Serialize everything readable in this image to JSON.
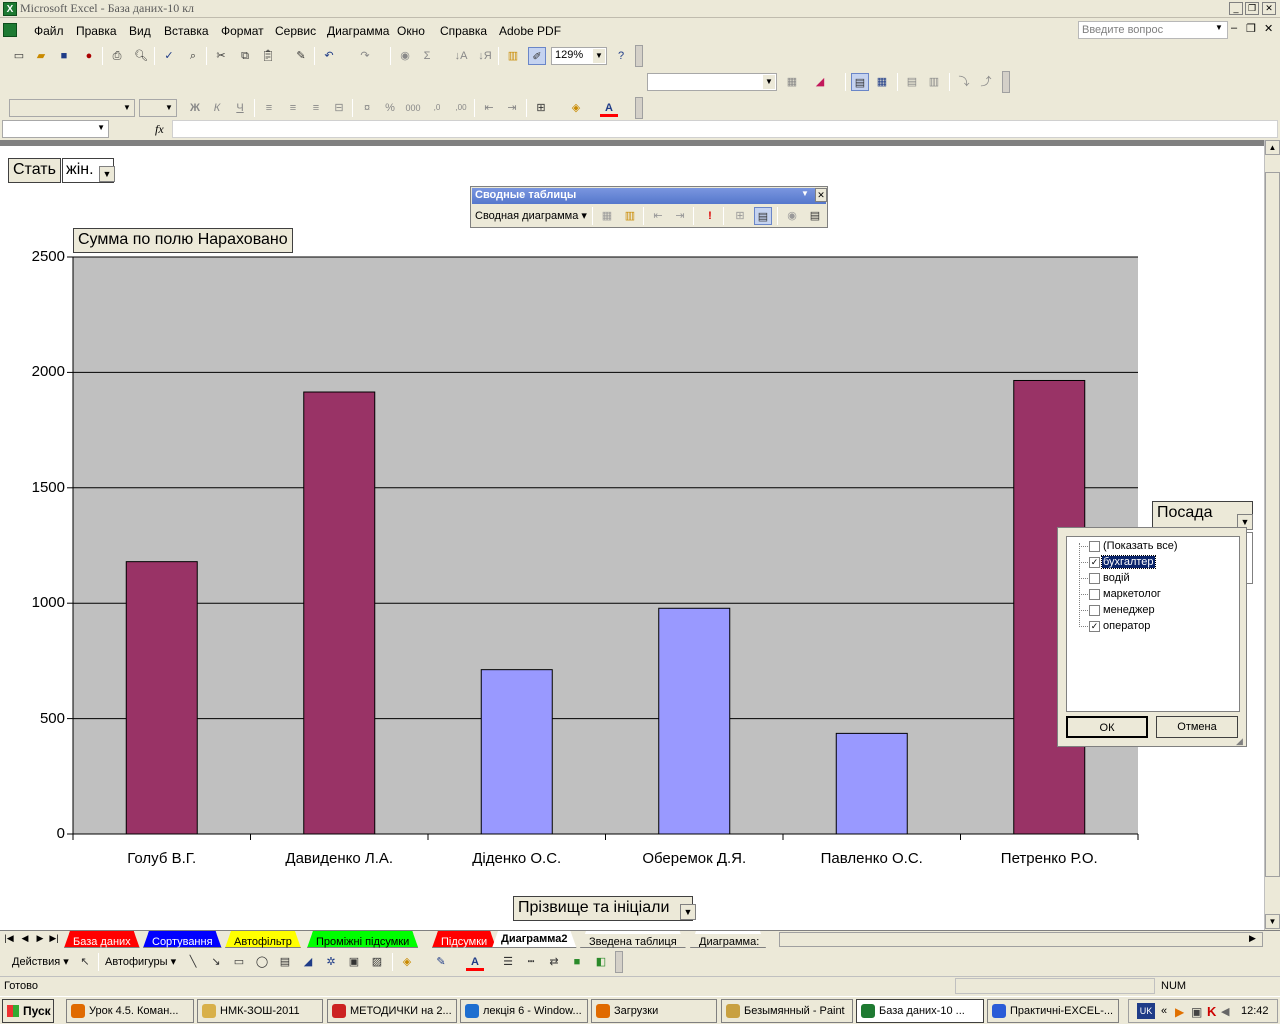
{
  "window": {
    "title": "Microsoft Excel - База даних-10 кл",
    "app_icon": "X"
  },
  "menu": {
    "items": [
      "Файл",
      "Правка",
      "Вид",
      "Вставка",
      "Формат",
      "Сервис",
      "Диаграмма",
      "Окно",
      "Справка",
      "Adobe PDF"
    ],
    "ask_placeholder": "Введите вопрос"
  },
  "toolbar": {
    "zoom": "129%"
  },
  "sheet": {
    "page_field_label": "Стать",
    "page_field_value": "жін.",
    "data_field_label": "Сумма по полю Нараховано",
    "category_field_label": "Прізвище та ініціали",
    "series_field_label": "Посада"
  },
  "pivot_toolbar": {
    "title": "Сводные таблицы",
    "menu_label": "Сводная диаграмма"
  },
  "chart_data": {
    "type": "bar",
    "categories": [
      "Голуб В.Г.",
      "Давиденко Л.А.",
      "Діденко О.С.",
      "Оберемок Д.Я.",
      "Павленко О.С.",
      "Петренко Р.О."
    ],
    "values": [
      1180,
      1915,
      712,
      978,
      436,
      1965
    ],
    "series_of_bar": [
      "бухгалтер",
      "бухгалтер",
      "оператор",
      "оператор",
      "оператор",
      "бухгалтер"
    ],
    "colors": {
      "бухгалтер": "#993366",
      "оператор": "#9999ff"
    },
    "ylim": [
      0,
      2500
    ],
    "yticks": [
      0,
      500,
      1000,
      1500,
      2000,
      2500
    ],
    "grid": true,
    "plot_background": "#c0c0c0"
  },
  "filter_dropdown": {
    "items": [
      {
        "label": "(Показать все)",
        "checked": false,
        "selected": false
      },
      {
        "label": "бухгалтер",
        "checked": true,
        "selected": true
      },
      {
        "label": "водій",
        "checked": false,
        "selected": false
      },
      {
        "label": "маркетолог",
        "checked": false,
        "selected": false
      },
      {
        "label": "менеджер",
        "checked": false,
        "selected": false
      },
      {
        "label": "оператор",
        "checked": true,
        "selected": false
      }
    ],
    "ok_label": "ОК",
    "cancel_label": "Отмена"
  },
  "sheet_tabs": [
    {
      "label": "База даних",
      "color": "#ff0000",
      "active": false
    },
    {
      "label": "Сортування",
      "color": "#0000ff",
      "active": false
    },
    {
      "label": "Автофільтр",
      "color": "#ffff00",
      "active": false
    },
    {
      "label": "Проміжні підсумки",
      "color": "#00ff00",
      "active": false
    },
    {
      "label": "Підсумки",
      "color": "#ff0000",
      "active": false
    },
    {
      "label": "Диаграмма2",
      "color": "#ffffff",
      "active": true
    },
    {
      "label": "Зведена таблиця",
      "color": "#ffffff",
      "active": false
    },
    {
      "label": "Диаграмма:",
      "color": "#ffffff",
      "active": false
    }
  ],
  "drawing": {
    "actions_label": "Действия",
    "autoshapes_label": "Автофигуры"
  },
  "status": {
    "left": "Готово",
    "num": "NUM"
  },
  "taskbar": {
    "start_label": "Пуск",
    "tasks": [
      {
        "label": "Урок 4.5. Коман...",
        "active": false
      },
      {
        "label": "НМК-ЗОШ-2011",
        "active": false
      },
      {
        "label": "МЕТОДИЧКИ на 2...",
        "active": false
      },
      {
        "label": "лекція 6 - Window...",
        "active": false
      },
      {
        "label": "Загрузки",
        "active": false
      },
      {
        "label": "Безымянный - Paint",
        "active": false
      },
      {
        "label": "База даних-10 ...",
        "active": true
      },
      {
        "label": "Практичні-EXCEL-...",
        "active": false
      }
    ],
    "lang": "UK",
    "clock": "12:42"
  }
}
